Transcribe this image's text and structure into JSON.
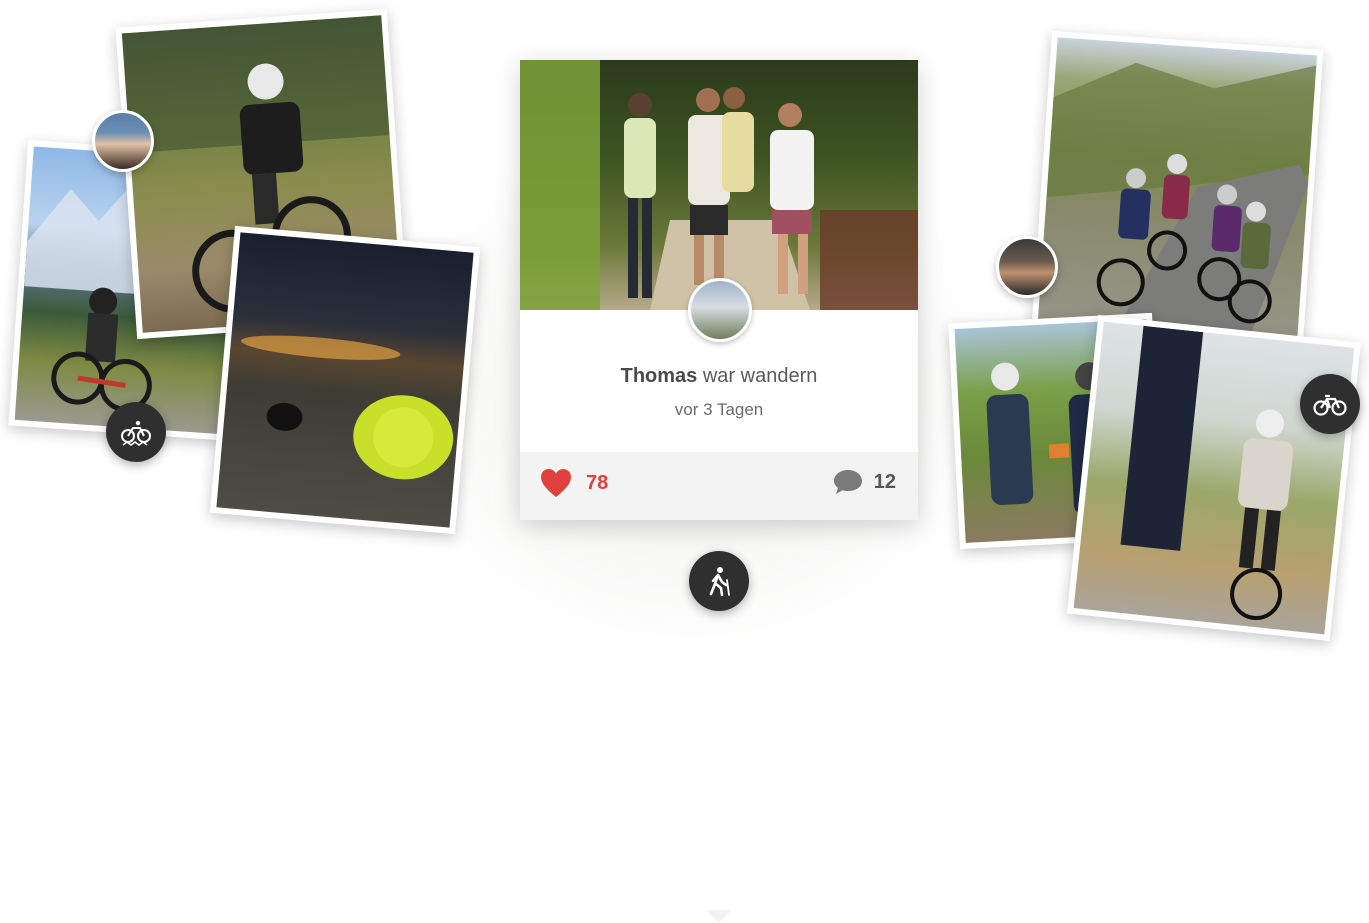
{
  "activity_card": {
    "user_name": "Thomas",
    "activity_text": "war wandern",
    "time_ago": "vor 3 Tagen",
    "likes_count": "78",
    "comments_count": "12",
    "activity_icon": "hiking-icon"
  },
  "feed_collage": {
    "left_group_icon": "mountain-bike-icon",
    "right_group_icon": "road-bike-icon"
  },
  "colors": {
    "like_red": "#e0413f",
    "badge_dark": "#2f2f2f",
    "footer_gray": "#f3f3f3"
  }
}
